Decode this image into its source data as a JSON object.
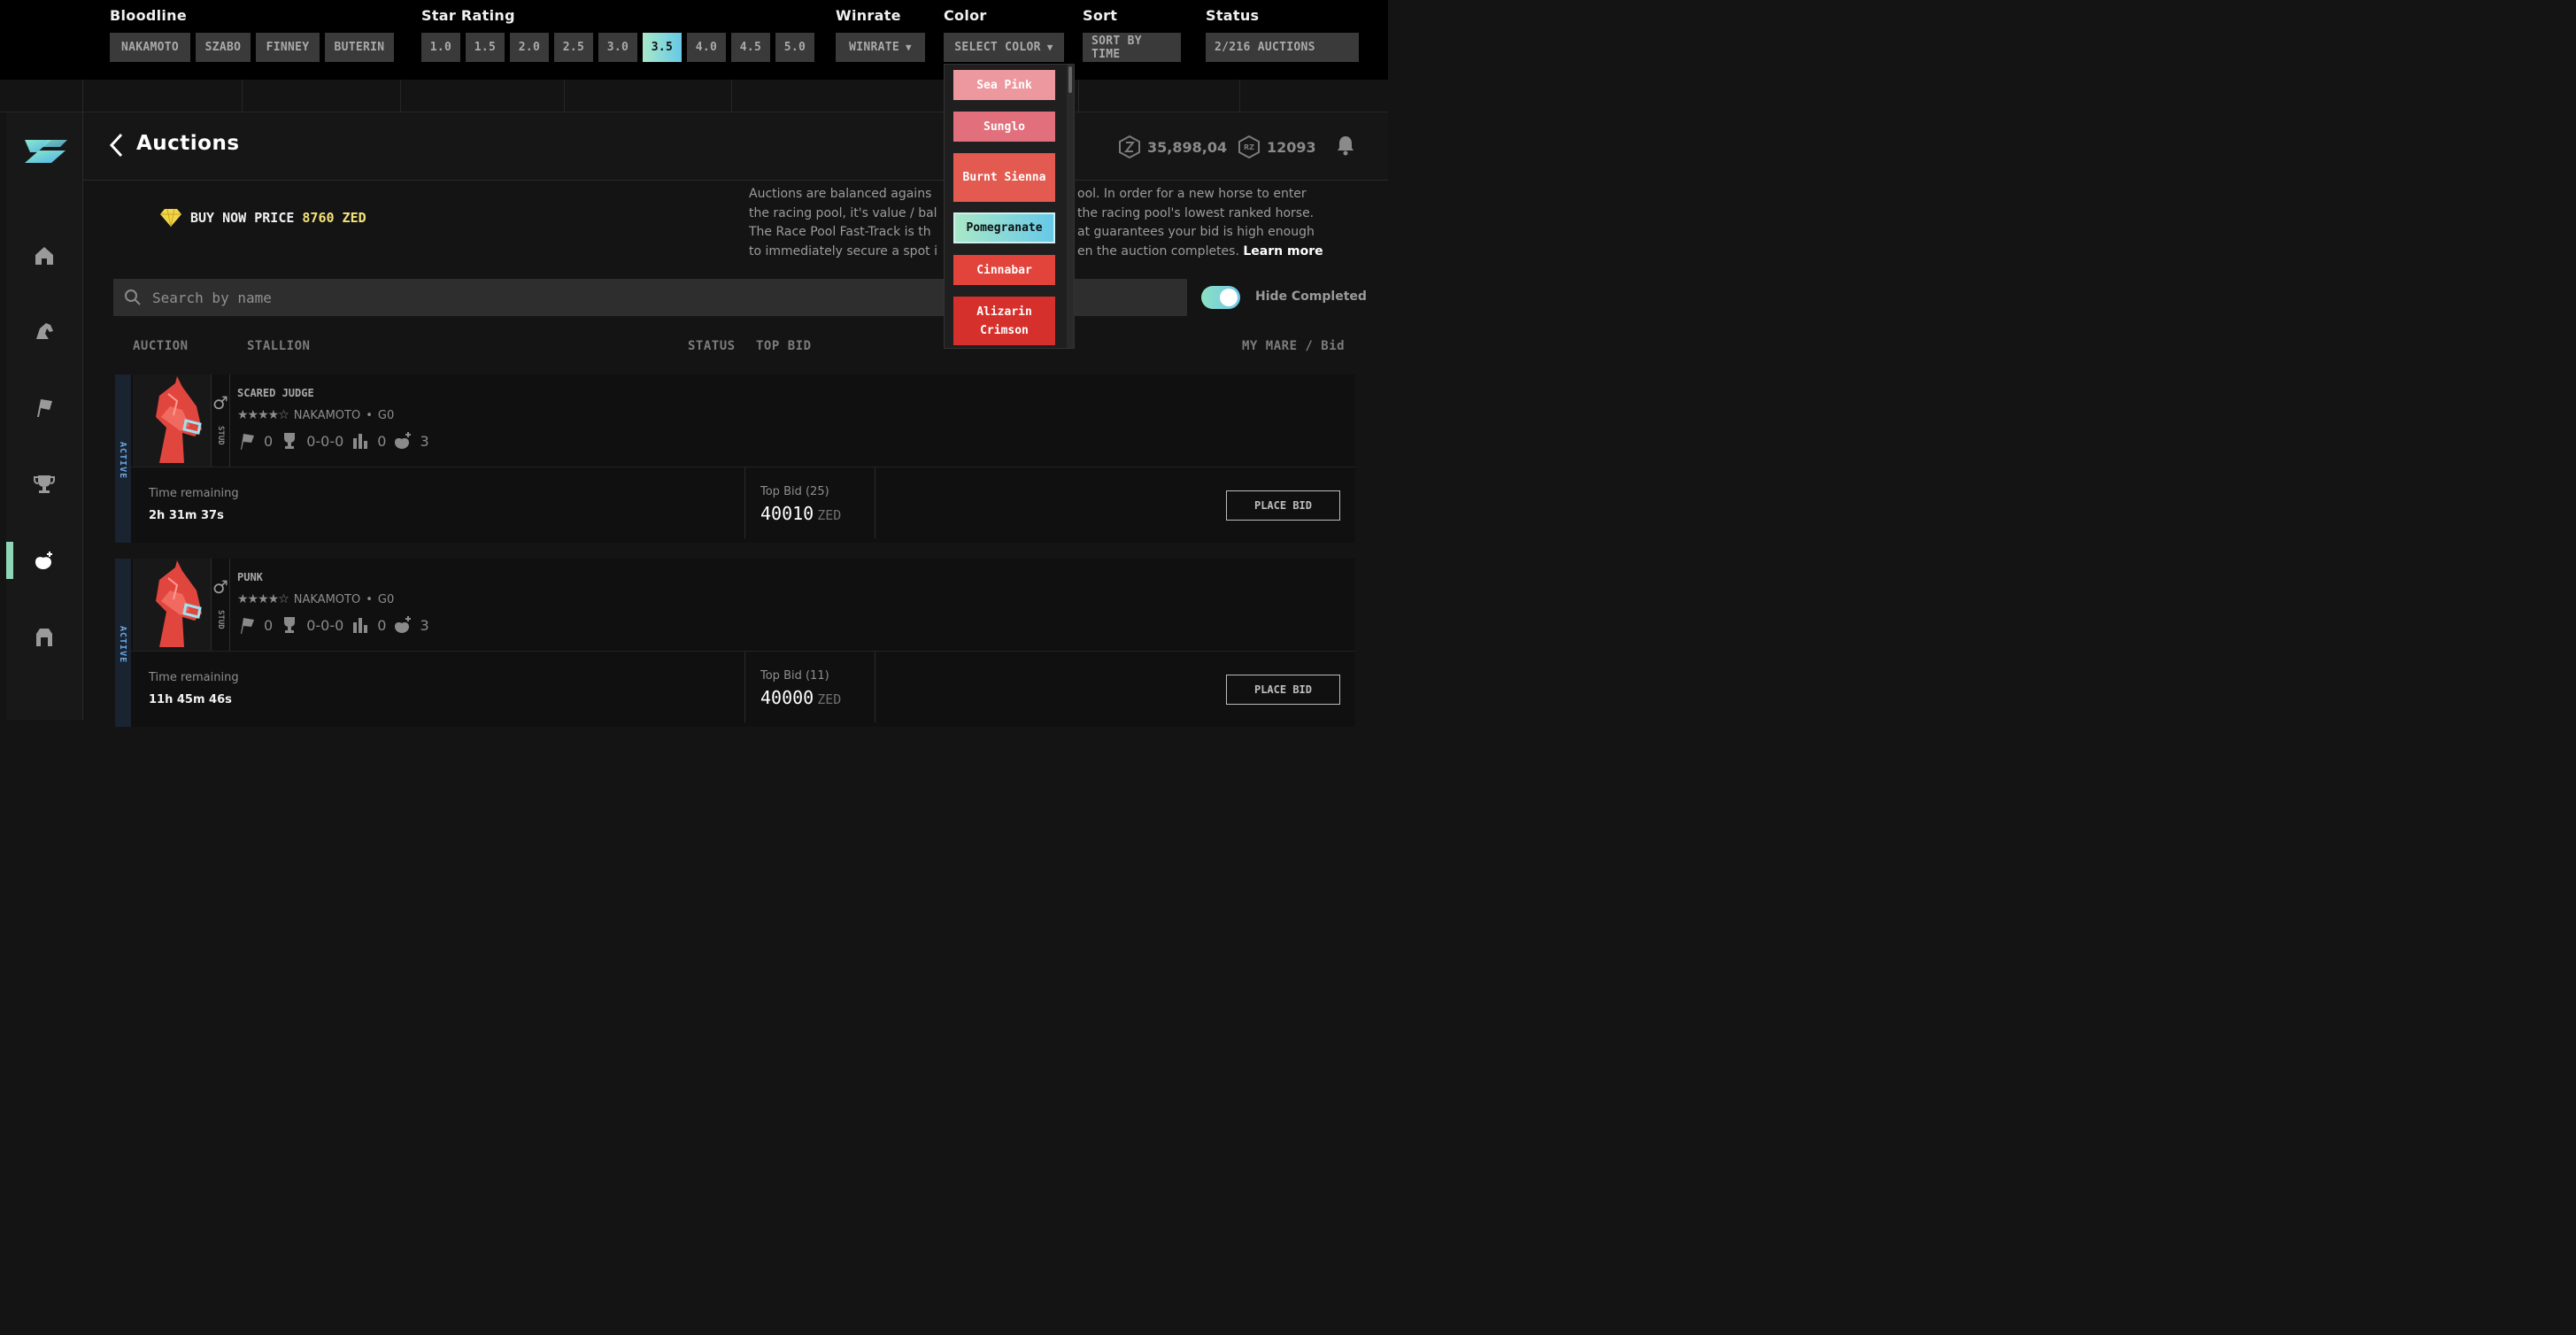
{
  "filters": {
    "bloodline": {
      "title": "Bloodline",
      "options": [
        "NAKAMOTO",
        "SZABO",
        "FINNEY",
        "BUTERIN"
      ]
    },
    "star_rating": {
      "title": "Star Rating",
      "options": [
        "1.0",
        "1.5",
        "2.0",
        "2.5",
        "3.0",
        "3.5",
        "4.0",
        "4.5",
        "5.0"
      ],
      "selected": "3.5"
    },
    "winrate": {
      "title": "Winrate",
      "value": "WINRATE"
    },
    "color": {
      "title": "Color",
      "value": "SELECT COLOR"
    },
    "sort": {
      "title": "Sort",
      "value": "SORT BY TIME"
    },
    "status": {
      "title": "Status",
      "value": "2/216 AUCTIONS"
    }
  },
  "color_dropdown": {
    "options": [
      {
        "label": "Sea Pink",
        "color": "#ED989E"
      },
      {
        "label": "Sunglo",
        "color": "#E16F7C"
      },
      {
        "label": "Burnt Sienna",
        "color": "#E35B50"
      },
      {
        "label": "Pomegranate",
        "color": "selected"
      },
      {
        "label": "Cinnabar",
        "color": "#E2433A"
      },
      {
        "label": "Alizarin Crimson",
        "color": "#D6302C"
      }
    ],
    "selected": "Pomegranate"
  },
  "header": {
    "title": "Auctions",
    "zed_balance": "35,898,04",
    "rz_balance": "12093"
  },
  "info": {
    "buy_now_label": "BUY NOW PRICE",
    "buy_now_price": "8760 ZED",
    "text_line1": "Auctions are balanced agains",
    "text_line1b": "ool. In order for a new horse to enter",
    "text_line2": "the racing pool, it's value / bal",
    "text_line2b": "the racing pool's lowest ranked horse.",
    "text_line3": "The Race Pool Fast-Track is th",
    "text_line3b": "at guarantees your bid is high enough",
    "text_line4": "to immediately secure a spot i",
    "text_line4b": "en the auction completes.",
    "learn_more": "Learn more"
  },
  "search": {
    "placeholder": "Search by name"
  },
  "hide_completed": {
    "label": "Hide Completed",
    "on": true
  },
  "columns": {
    "auction": "AUCTION",
    "stallion": "STALLION",
    "status": "STATUS",
    "top_bid": "TOP BID",
    "my_mare": "MY MARE / Bid"
  },
  "auctions": [
    {
      "status": "ACTIVE",
      "name": "SCARED JUDGE",
      "bloodline": "NAKAMOTO",
      "generation": "G0",
      "sex_label": "STUD",
      "races": "0",
      "record": "0-0-0",
      "stat3": "0",
      "offspring": "3",
      "time_label": "Time remaining",
      "time_value": "2h 31m 37s",
      "top_bid_label": "Top Bid (25)",
      "top_bid_value": "40010",
      "currency": "ZED",
      "button": "PLACE BID"
    },
    {
      "status": "ACTIVE",
      "name": "PUNK",
      "bloodline": "NAKAMOTO",
      "generation": "G0",
      "sex_label": "STUD",
      "races": "0",
      "record": "0-0-0",
      "stat3": "0",
      "offspring": "3",
      "time_label": "Time remaining",
      "time_value": "11h 45m 46s",
      "top_bid_label": "Top Bid (11)",
      "top_bid_value": "40000",
      "currency": "ZED",
      "button": "PLACE BID"
    }
  ],
  "icons": {
    "logo": "zed-logo",
    "nav": [
      "home-icon",
      "horse-icon",
      "flag-icon",
      "trophy-icon",
      "breeding-icon",
      "stable-icon"
    ]
  }
}
